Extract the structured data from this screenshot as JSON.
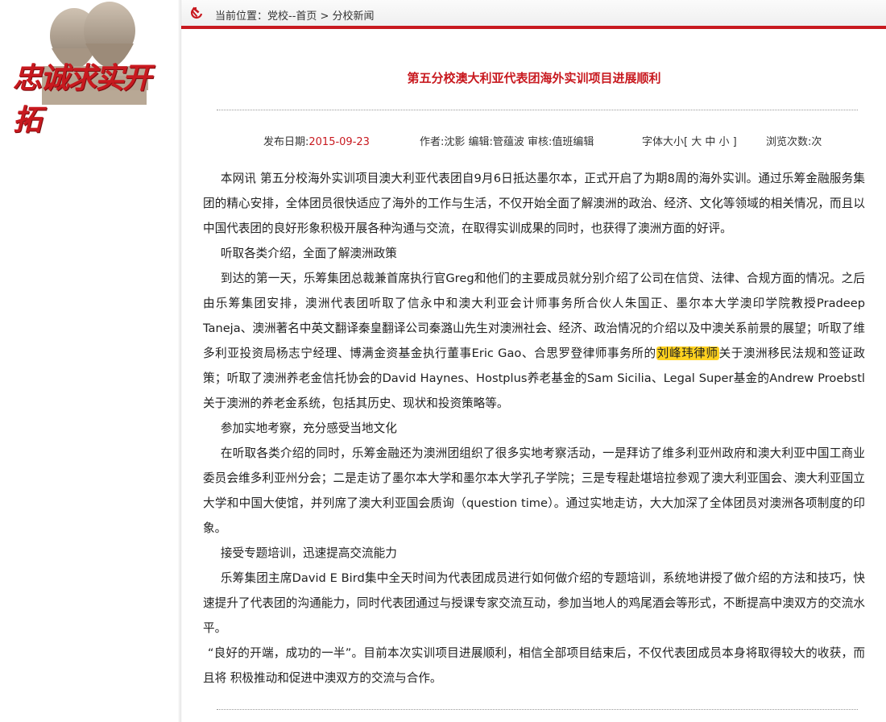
{
  "sidebar": {
    "logo_text": "忠诚求实开拓"
  },
  "topbar": {
    "breadcrumb": "当前位置：党校--首页 > 分校新闻"
  },
  "article": {
    "title": "第五分校澳大利亚代表团海外实训项目进展顺利",
    "meta": {
      "date_label": "发布日期:",
      "date_value": "2015-09-23",
      "authors": "作者:沈影 编辑:管蕴波 审核:值班编辑",
      "font_size": "字体大小[ 大 中 小 ]",
      "views": "浏览次数:次"
    },
    "p1": "本网讯 第五分校海外实训项目澳大利亚代表团自9月6日抵达墨尔本，正式开启了为期8周的海外实训。通过乐筹金融服务集团的精心安排，全体团员很快适应了海外的工作与生活，不仅开始全面了解澳洲的政治、经济、文化等领域的相关情况，而且以中国代表团的良好形象积极开展各种沟通与交流，在取得实训成果的同时，也获得了澳洲方面的好评。",
    "h1": "听取各类介绍，全面了解澳洲政策",
    "p2a": "到达的第一天，乐筹集团总裁兼首席执行官Greg和他们的主要成员就分别介绍了公司在信贷、法律、合规方面的情况。之后由乐筹集团安排，澳洲代表团听取了信永中和澳大利亚会计师事务所合伙人朱国正、墨尔本大学澳印学院教授Pradeep Taneja、澳洲著名中英文翻译秦皇翻译公司秦潞山先生对澳洲社会、经济、政治情况的介绍以及中澳关系前景的展望；听取了维多利亚投资局杨志宁经理、博满金资基金执行董事Eric Gao、合思罗登律师事务所的",
    "p2_highlight": "刘峰玮律师",
    "p2b": "关于澳洲移民法规和签证政策；听取了澳洲养老金信托协会的David Haynes、Hostplus养老基金的Sam Sicilia、Legal Super基金的Andrew Proebstl关于澳洲的养老金系统，包括其历史、现状和投资策略等。",
    "h2": "参加实地考察，充分感受当地文化",
    "p3": "在听取各类介绍的同时，乐筹金融还为澳洲团组织了很多实地考察活动，一是拜访了维多利亚州政府和澳大利亚中国工商业委员会维多利亚州分会；二是走访了墨尔本大学和墨尔本大学孔子学院；三是专程赴堪培拉参观了澳大利亚国会、澳大利亚国立大学和中国大使馆，并列席了澳大利亚国会质询（question time）。通过实地走访，大大加深了全体团员对澳洲各项制度的印象。",
    "h3": "接受专题培训，迅速提高交流能力",
    "p4": "乐筹集团主席David E Bird集中全天时间为代表团成员进行如何做介绍的专题培训，系统地讲授了做介绍的方法和技巧，快速提升了代表团的沟通能力，同时代表团通过与授课专家交流互动，参加当地人的鸡尾酒会等形式，不断提高中澳双方的交流水平。",
    "p5": "“良好的开端，成功的一半”。目前本次实训项目进展顺利，相信全部项目结束后，不仅代表团成员本身将取得较大的收获，而且将 积极推动和促进中澳双方的交流与合作。"
  },
  "colors": {
    "accent_red": "#c8191f",
    "highlight": "#ffd21f"
  },
  "icons": {
    "party": "hammer-sickle-icon"
  }
}
